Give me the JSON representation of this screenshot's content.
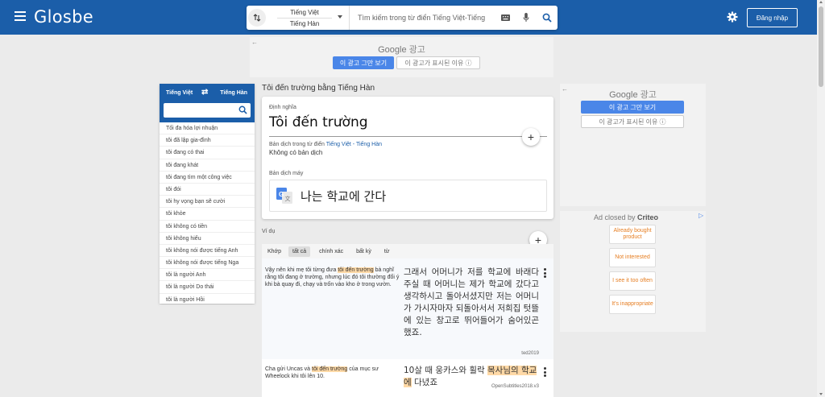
{
  "app": {
    "logo": "Glosbe",
    "login_label": "Đăng nhập"
  },
  "search": {
    "from_lang": "Tiếng Việt",
    "to_lang": "Tiếng Hàn",
    "placeholder": "Tìm kiếm trong từ điển Tiếng Việt-Tiếng"
  },
  "ads": {
    "google_label": "Google",
    "google_suffix": "광고",
    "stop_label": "이 광고 그만 보기",
    "why_label": "이 광고가 표시된 이유 ⓘ",
    "closed_by": "Ad closed by",
    "criteo": "Criteo",
    "info_mark": "▷",
    "reasons": [
      "Already bought product",
      "Not interested",
      "I see it too often",
      "It's inappropriate"
    ]
  },
  "sidebar": {
    "from": "Tiếng Việt",
    "to": "Tiếng Hàn",
    "items": [
      "Tối đa hóa lợi nhuận",
      "tôi đã lập gia-đình",
      "tôi đang có thai",
      "tôi đang khát",
      "tôi đang tìm một công việc",
      "tôi đói",
      "tôi hy vọng bạn sẽ cười",
      "tôi khỏe",
      "tôi không có tiền",
      "tôi không hiểu",
      "tôi không nói được tiếng Anh",
      "tôi không nói được tiếng Nga",
      "tôi là người Anh",
      "tôi là người Do thái",
      "tôi là người Hồi"
    ]
  },
  "main": {
    "title": "Tôi đến trường bằng Tiếng Hàn",
    "def_label": "Định nghĩa",
    "headword": "Tôi đến trường",
    "dict_prefix": "Bản dịch trong từ điển",
    "dict_pair": "Tiếng Việt - Tiếng Hàn",
    "no_translation": "Không có bản dịch",
    "mt_label": "Bản dịch máy",
    "mt_text": "나는 학교에 간다",
    "plus": "+"
  },
  "examples": {
    "label": "Ví dụ",
    "filters": [
      "Khớp",
      "tất cả",
      "chính xác",
      "bất kỳ",
      "từ"
    ],
    "items": [
      {
        "src_before": "Vậy nên khi mẹ tôi từng đưa ",
        "src_hl": "tôi đến trường",
        "src_after": " bà nghĩ rằng tôi đang ở trường, nhưng lúc đó tôi thường đổi ý khi bà quay đi, chạy và trốn vào kho ở trong vườn.",
        "tgt": "그래서 어머니가 저를 학교에 바래다 주실 때 어머니는 제가 학교에 갔다고 생각하시고 돌아서셨지만 저는 어머니가 가시자마자 되돌아서서 저희집 텃뜰에 있는 창고로 뛰어들어가 숨어있곤 했죠.",
        "source": "ted2019"
      },
      {
        "src_before": "Cha gửi Uncas và ",
        "src_hl": "tôi đến trường",
        "src_after": " của mục sư Wheelock khi tôi lên 10.",
        "tgt_before": "10살 때 웅카스와 휠락 ",
        "tgt_hl": "목사님의 학교에",
        "tgt_after": " 다녔죠",
        "source": "OpenSubtitles2018.v3"
      }
    ]
  }
}
